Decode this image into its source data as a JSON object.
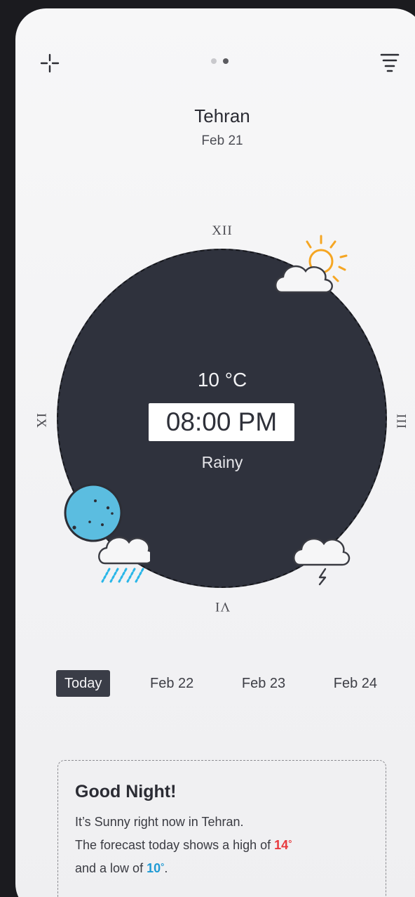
{
  "header": {
    "move_icon": "move-crosshair-icon",
    "filter_icon": "filter-lines-icon",
    "page_count": 2,
    "active_page": 2
  },
  "location": {
    "city": "Tehran",
    "date": "Feb 21"
  },
  "clock": {
    "numerals": {
      "twelve": "XII",
      "three": "III",
      "six": "VI",
      "nine": "IX"
    },
    "temperature": "10 °C",
    "time": "08:00 PM",
    "condition": "Rainy",
    "icons": [
      "sun-cloud-icon",
      "rain-cloud-icon",
      "storm-cloud-icon",
      "moon-knob-icon"
    ]
  },
  "tabs": [
    {
      "label": "Today",
      "active": true
    },
    {
      "label": "Feb 22",
      "active": false
    },
    {
      "label": "Feb 23",
      "active": false
    },
    {
      "label": "Feb 24",
      "active": false
    }
  ],
  "message": {
    "title": "Good Night!",
    "line1": "It’s Sunny right now in Tehran.",
    "line2_prefix": "The forecast today shows a high of ",
    "high": "14",
    "line3_prefix": "and a low of ",
    "low": "10",
    "degree": "°",
    "line3_suffix": "."
  },
  "colors": {
    "clock_face": "#2f323d",
    "high_temp": "#e8393d",
    "low_temp": "#1f9ad4",
    "sun": "#f5a623",
    "rain": "#29b6e8"
  }
}
